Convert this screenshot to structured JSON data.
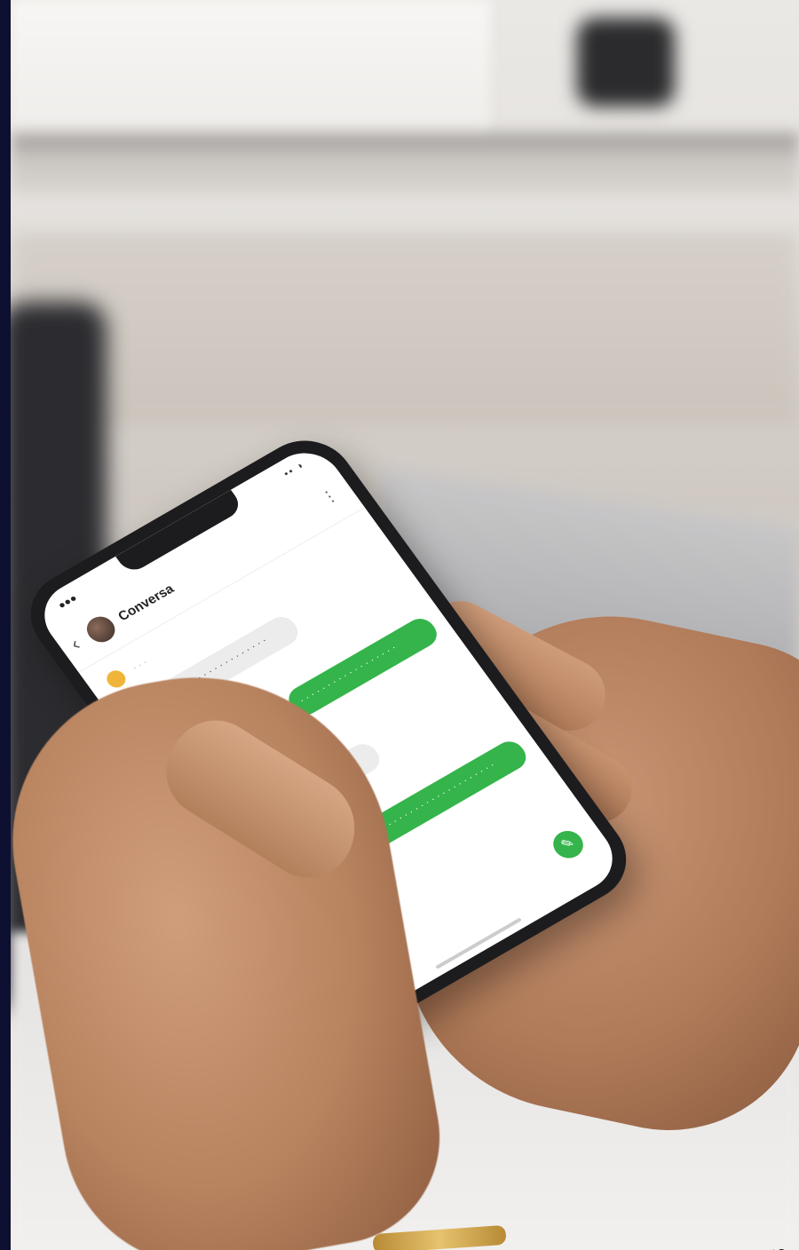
{
  "phone": {
    "status_time": "●●●",
    "status_icons": "▪▪ ◗",
    "contact_name": "Conversa",
    "system_line": "· · ·"
  },
  "messages": [
    {
      "side": "in",
      "text": "· · · · · · · · · · · · · · · · · · · · · · · ·"
    },
    {
      "side": "out",
      "text": "· · · · · · · · · · · · · · · · · ·"
    },
    {
      "side": "in",
      "text": "· · · · · · · · · · · · · · · · · · · · ·"
    },
    {
      "side": "out",
      "text": "· · · · · · · · · · · · · · · · · · · · · · · ·"
    }
  ],
  "corner_label": "S",
  "colors": {
    "outgoing_bubble": "#34b44a",
    "incoming_bubble": "#ececec",
    "phone_frame": "#1c1c1e"
  },
  "icons": [
    "back-arrow-icon",
    "menu-dots-icon",
    "compose-icon"
  ]
}
